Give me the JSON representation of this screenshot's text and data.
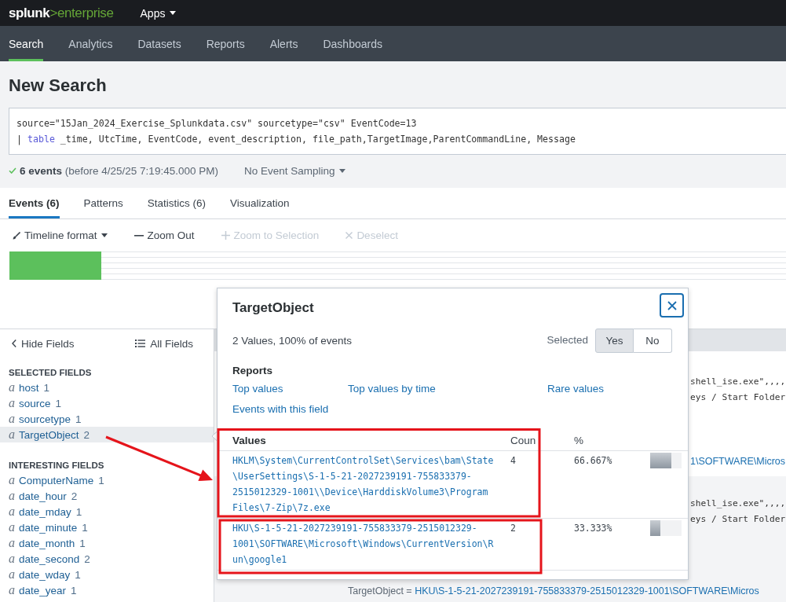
{
  "top_bar": {
    "logo": {
      "brand": "splunk",
      "product": ">enterprise"
    },
    "apps_menu": {
      "label": "Apps"
    }
  },
  "nav": [
    {
      "label": "Search",
      "selected": true
    },
    {
      "label": "Analytics",
      "selected": false
    },
    {
      "label": "Datasets",
      "selected": false
    },
    {
      "label": "Reports",
      "selected": false
    },
    {
      "label": "Alerts",
      "selected": false
    },
    {
      "label": "Dashboards",
      "selected": false
    }
  ],
  "page_title": "New Search",
  "search": {
    "query_lines": [
      [
        {
          "kind": "plain",
          "text": "source=\"15Jan_2024_Exercise_Splunkdata.csv\" sourcetype=\"csv\" EventCode=13"
        }
      ],
      [
        {
          "kind": "plain",
          "text": "| "
        },
        {
          "kind": "command",
          "text": "table"
        },
        {
          "kind": "plain",
          "text": " _time, UtcTime, EventCode, event_description, file_path,TargetImage,ParentCommandLine, Message"
        }
      ]
    ]
  },
  "status": {
    "summary": "**6 events** (before 4/25/25 7:19:45.000 PM)",
    "sampling": "No Event Sampling"
  },
  "result_tabs": [
    {
      "label": "Events (6)",
      "selected": true
    },
    {
      "label": "Patterns",
      "selected": false
    },
    {
      "label": "Statistics (6)",
      "selected": false
    },
    {
      "label": "Visualization",
      "selected": false
    }
  ],
  "timeline_toolbar": [
    {
      "kind": "format",
      "label": "Timeline format",
      "disabled": false
    },
    {
      "kind": "zoom_out",
      "label": "Zoom Out",
      "disabled": false
    },
    {
      "kind": "zoom_in",
      "label": "Zoom to Selection",
      "disabled": true
    },
    {
      "kind": "deselect",
      "label": "Deselect",
      "disabled": true
    }
  ],
  "sidebar": {
    "hide_fields": "Hide Fields",
    "all_fields": "All Fields",
    "groups": [
      {
        "title": "SELECTED FIELDS",
        "fields": [
          {
            "type": "a",
            "name": "host",
            "count": "1",
            "selected": false
          },
          {
            "type": "a",
            "name": "source",
            "count": "1",
            "selected": false
          },
          {
            "type": "a",
            "name": "sourcetype",
            "count": "1",
            "selected": false
          },
          {
            "type": "a",
            "name": "TargetObject",
            "count": "2",
            "selected": true
          }
        ]
      },
      {
        "title": "INTERESTING FIELDS",
        "fields": [
          {
            "type": "a",
            "name": "ComputerName",
            "count": "1",
            "selected": false
          },
          {
            "type": "a",
            "name": "date_hour",
            "count": "2",
            "selected": false
          },
          {
            "type": "a",
            "name": "date_mday",
            "count": "1",
            "selected": false
          },
          {
            "type": "a",
            "name": "date_minute",
            "count": "1",
            "selected": false
          },
          {
            "type": "a",
            "name": "date_month",
            "count": "1",
            "selected": false
          },
          {
            "type": "a",
            "name": "date_second",
            "count": "2",
            "selected": false
          },
          {
            "type": "a",
            "name": "date_wday",
            "count": "1",
            "selected": false
          },
          {
            "type": "a",
            "name": "date_year",
            "count": "1",
            "selected": false
          }
        ]
      }
    ]
  },
  "events": [
    {
      "lines": [
        "shell_ise.exe\",,,,",
        "eys / Start Folder"
      ],
      "target": {
        "value": "1\\SOFTWARE\\Micros"
      }
    },
    {
      "lines": [
        "shell_ise.exe\",,,,",
        "eys / Start Folder"
      ],
      "target": {
        "label": "TargetObject =",
        "value": "HKU\\S-1-5-21-2027239191-755833379-2515012329-1001\\SOFTWARE\\Micros"
      }
    }
  ],
  "field_popup": {
    "title": "TargetObject",
    "summary": "2 Values, 100% of events",
    "selected_label": "Selected",
    "selected_options": [
      {
        "label": "Yes",
        "selected": true
      },
      {
        "label": "No",
        "selected": false
      }
    ],
    "reports_heading": "Reports",
    "reports": [
      "Top values",
      "Top values by time",
      "Rare values",
      "Events with this field"
    ],
    "columns": [
      "Values",
      "Coun",
      "%"
    ],
    "values": [
      {
        "value": "HKLM\\System\\CurrentControlSet\\Services\\bam\\State\\UserSettings\\S-1-5-21-2027239191-755833379-2515012329-1001\\\\Device\\HarddiskVolume3\\Program Files\\7-Zip\\7z.exe",
        "count": "4",
        "percent": "66.667%",
        "level": 0.66667
      },
      {
        "value": "HKU\\S-1-5-21-2027239191-755833379-2515012329-1001\\SOFTWARE\\Microsoft\\Windows\\CurrentVersion\\Run\\google1",
        "count": "2",
        "percent": "33.333%",
        "level": 0.33333
      }
    ]
  }
}
